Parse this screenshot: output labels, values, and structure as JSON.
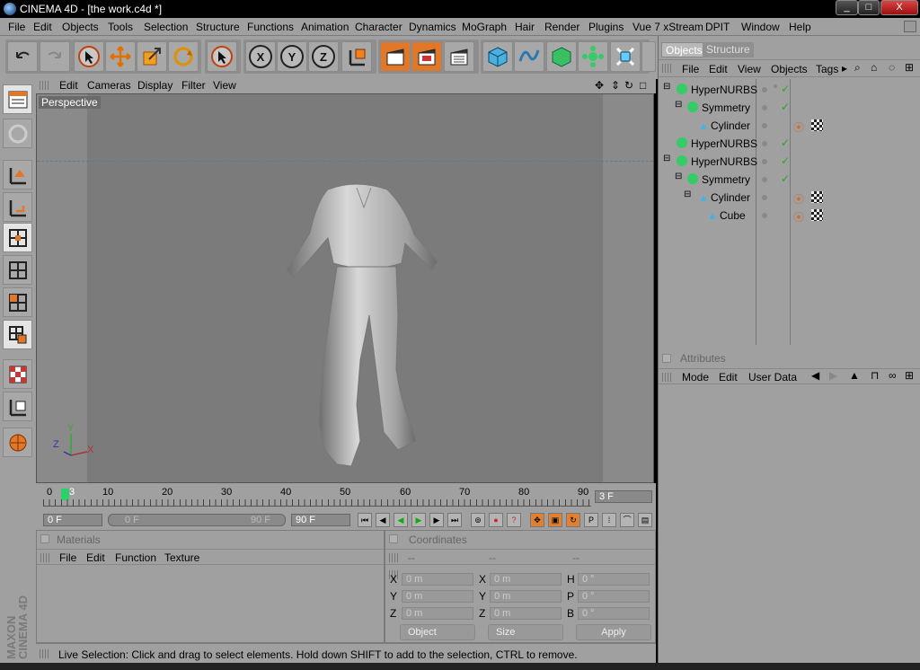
{
  "window": {
    "title": "CINEMA 4D - [the work.c4d *]",
    "min": "_",
    "max": "□",
    "close": "X"
  },
  "menu": [
    "File",
    "Edit",
    "Objects",
    "Tools",
    "Selection",
    "Structure",
    "Functions",
    "Animation",
    "Character",
    "Dynamics",
    "MoGraph",
    "Hair",
    "Render",
    "Plugins",
    "Vue 7 xStream",
    "DPIT",
    "Window",
    "Help"
  ],
  "viewport": {
    "menu": [
      "Edit",
      "Cameras",
      "Display",
      "Filter",
      "View"
    ],
    "label": "Perspective",
    "axis_y": "Y",
    "axis_z": "Z",
    "axis_x": "X"
  },
  "timeline": {
    "ticks": [
      "0",
      "10",
      "20",
      "30",
      "40",
      "50",
      "60",
      "70",
      "80",
      "90"
    ],
    "current_marker": "3",
    "current_frame": "3 F",
    "start": "0 F",
    "range_start": "0 F",
    "range_end": "90 F",
    "end": "90 F"
  },
  "materials": {
    "title": "Materials",
    "menu": [
      "File",
      "Edit",
      "Function",
      "Texture"
    ]
  },
  "coordinates": {
    "title": "Coordinates",
    "col_headers": [
      "--",
      "--",
      "--"
    ],
    "rows": [
      {
        "l1": "X",
        "v1": "0 m",
        "l2": "X",
        "v2": "0 m",
        "l3": "H",
        "v3": "0 °"
      },
      {
        "l1": "Y",
        "v1": "0 m",
        "l2": "Y",
        "v2": "0 m",
        "l3": "P",
        "v3": "0 °"
      },
      {
        "l1": "Z",
        "v1": "0 m",
        "l2": "Z",
        "v2": "0 m",
        "l3": "B",
        "v3": "0 °"
      }
    ],
    "mode": "Object",
    "size": "Size",
    "apply": "Apply"
  },
  "status": "Live Selection: Click and drag to select elements. Hold down SHIFT to add to the selection, CTRL to remove.",
  "objects_panel": {
    "tabs": [
      "Objects",
      "Structure"
    ],
    "menu": [
      "File",
      "Edit",
      "View",
      "Objects",
      "Tags"
    ],
    "items": [
      {
        "name": "HyperNURBS",
        "tags": false
      },
      {
        "name": "Symmetry",
        "tags": false
      },
      {
        "name": "Cylinder",
        "tags": true
      },
      {
        "name": "HyperNURBS",
        "tags": false
      },
      {
        "name": "HyperNURBS",
        "tags": false
      },
      {
        "name": "Symmetry",
        "tags": false
      },
      {
        "name": "Cylinder",
        "tags": true
      },
      {
        "name": "Cube",
        "tags": true
      }
    ]
  },
  "attributes_panel": {
    "title": "Attributes",
    "menu": [
      "Mode",
      "Edit",
      "User Data"
    ]
  },
  "brand": {
    "line1": "MAXON",
    "line2": "CINEMA 4D"
  },
  "colors": {
    "ui_gray": "#a0a0a0",
    "accent_orange": "#e07828",
    "viewport": "#7b7b7b"
  }
}
